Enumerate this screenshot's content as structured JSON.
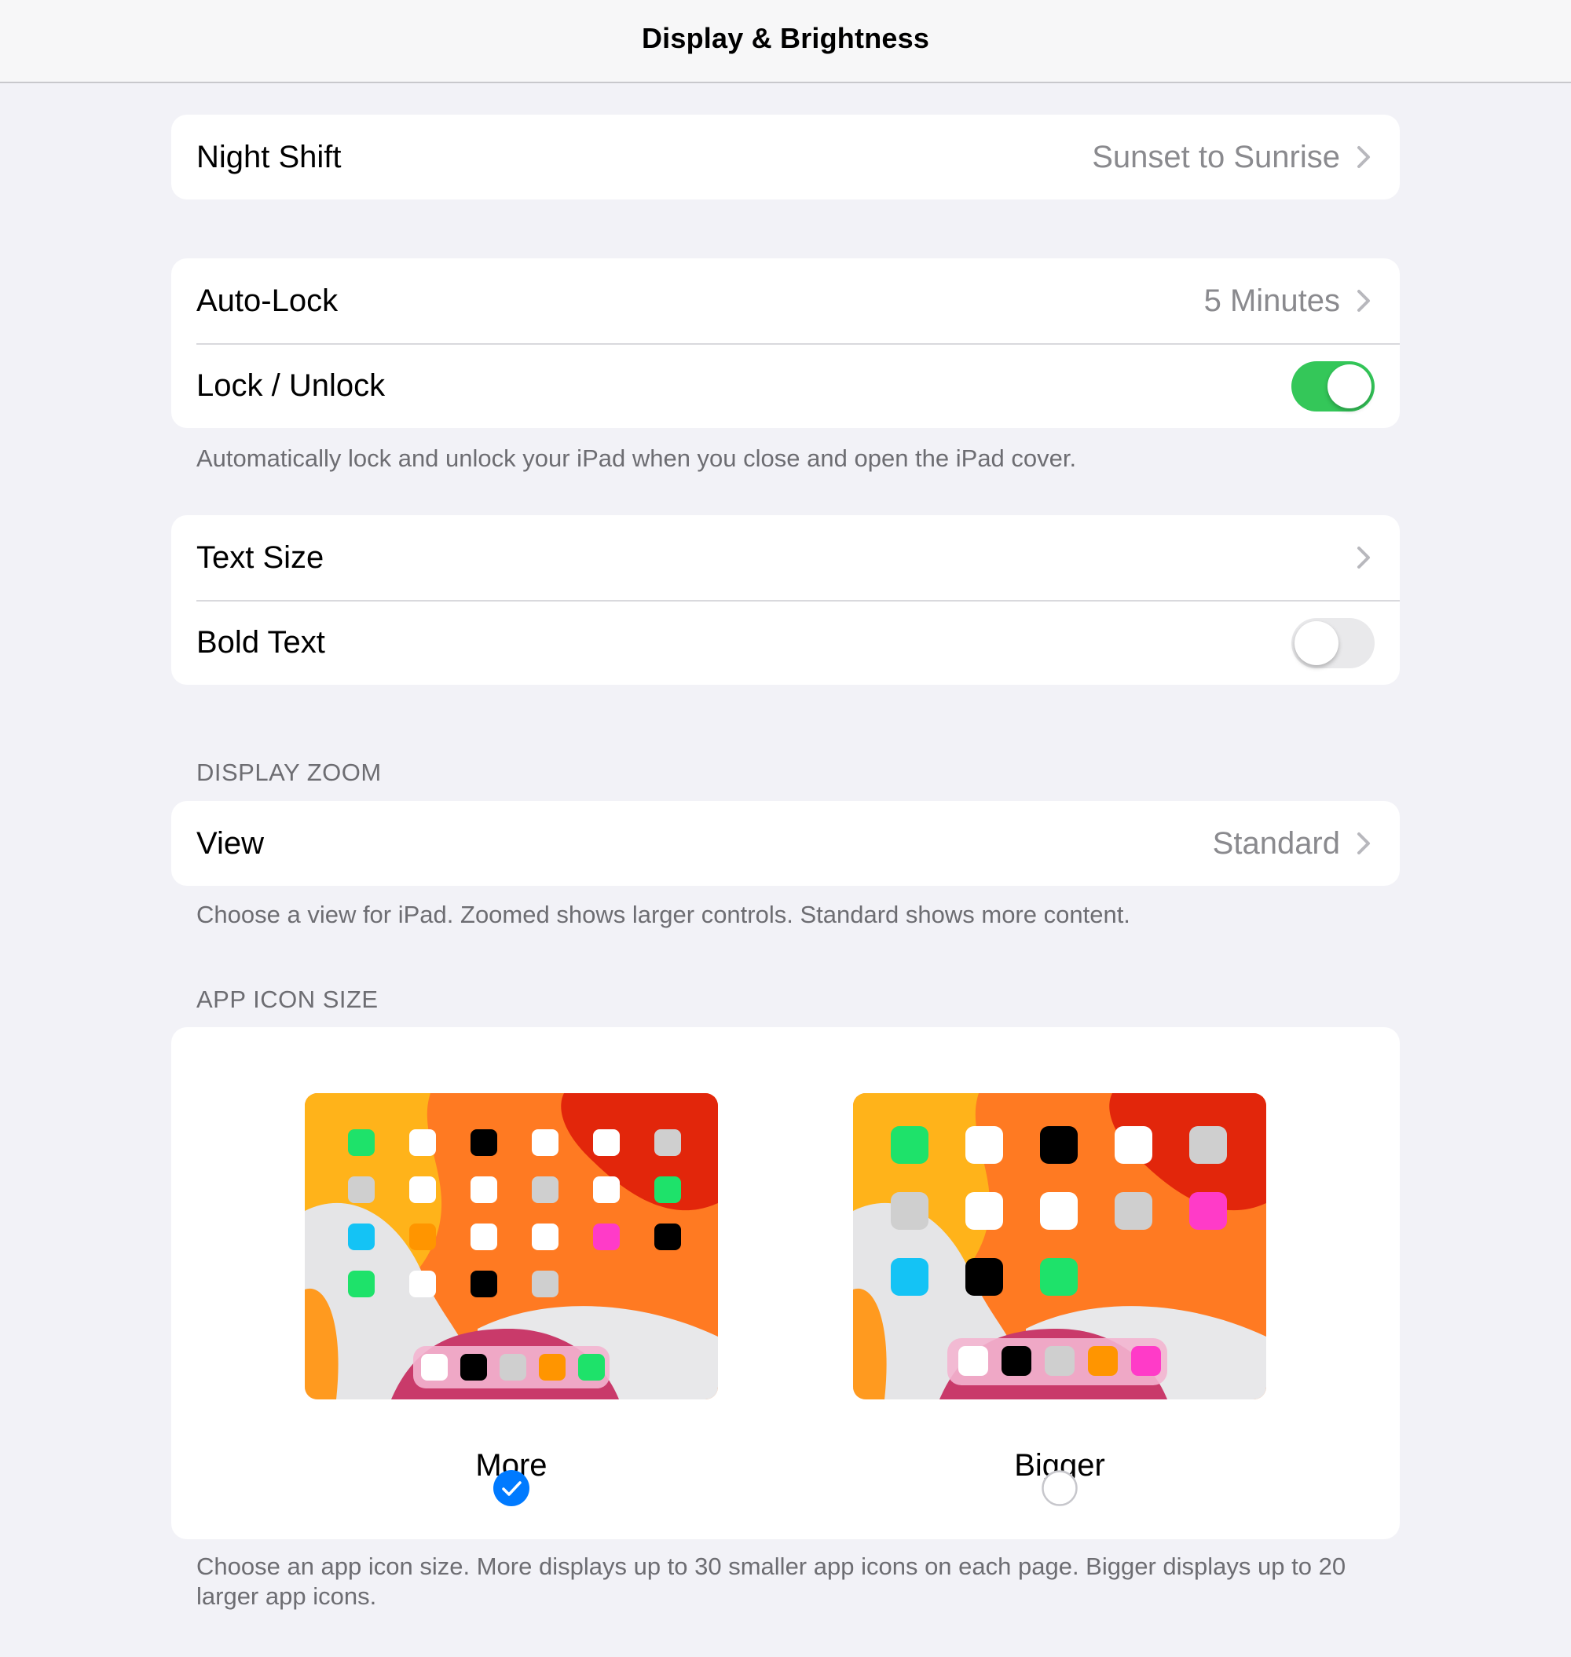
{
  "nav": {
    "title": "Display & Brightness"
  },
  "night_shift": {
    "label": "Night Shift",
    "value": "Sunset to Sunrise"
  },
  "lock_group": {
    "auto_lock": {
      "label": "Auto-Lock",
      "value": "5 Minutes"
    },
    "lock_unlock": {
      "label": "Lock / Unlock",
      "on": true
    },
    "footer": "Automatically lock and unlock your iPad when you close and open the iPad cover."
  },
  "text_group": {
    "text_size": {
      "label": "Text Size"
    },
    "bold_text": {
      "label": "Bold Text",
      "on": false
    }
  },
  "display_zoom": {
    "header": "DISPLAY ZOOM",
    "view": {
      "label": "View",
      "value": "Standard"
    },
    "footer": "Choose a view for iPad. Zoomed shows larger controls. Standard shows more content."
  },
  "app_icon_size": {
    "header": "APP ICON SIZE",
    "options": [
      {
        "label": "More",
        "selected": true
      },
      {
        "label": "Bigger",
        "selected": false
      }
    ],
    "footer": "Choose an app icon size. More displays up to 30 smaller app icons on each page. Bigger displays up to 20 larger app icons."
  },
  "colors": {
    "toggle_on": "#34c759",
    "toggle_off": "#e9e9eb",
    "selected_radio": "#007aff",
    "secondary_text": "#8a8a8e"
  }
}
